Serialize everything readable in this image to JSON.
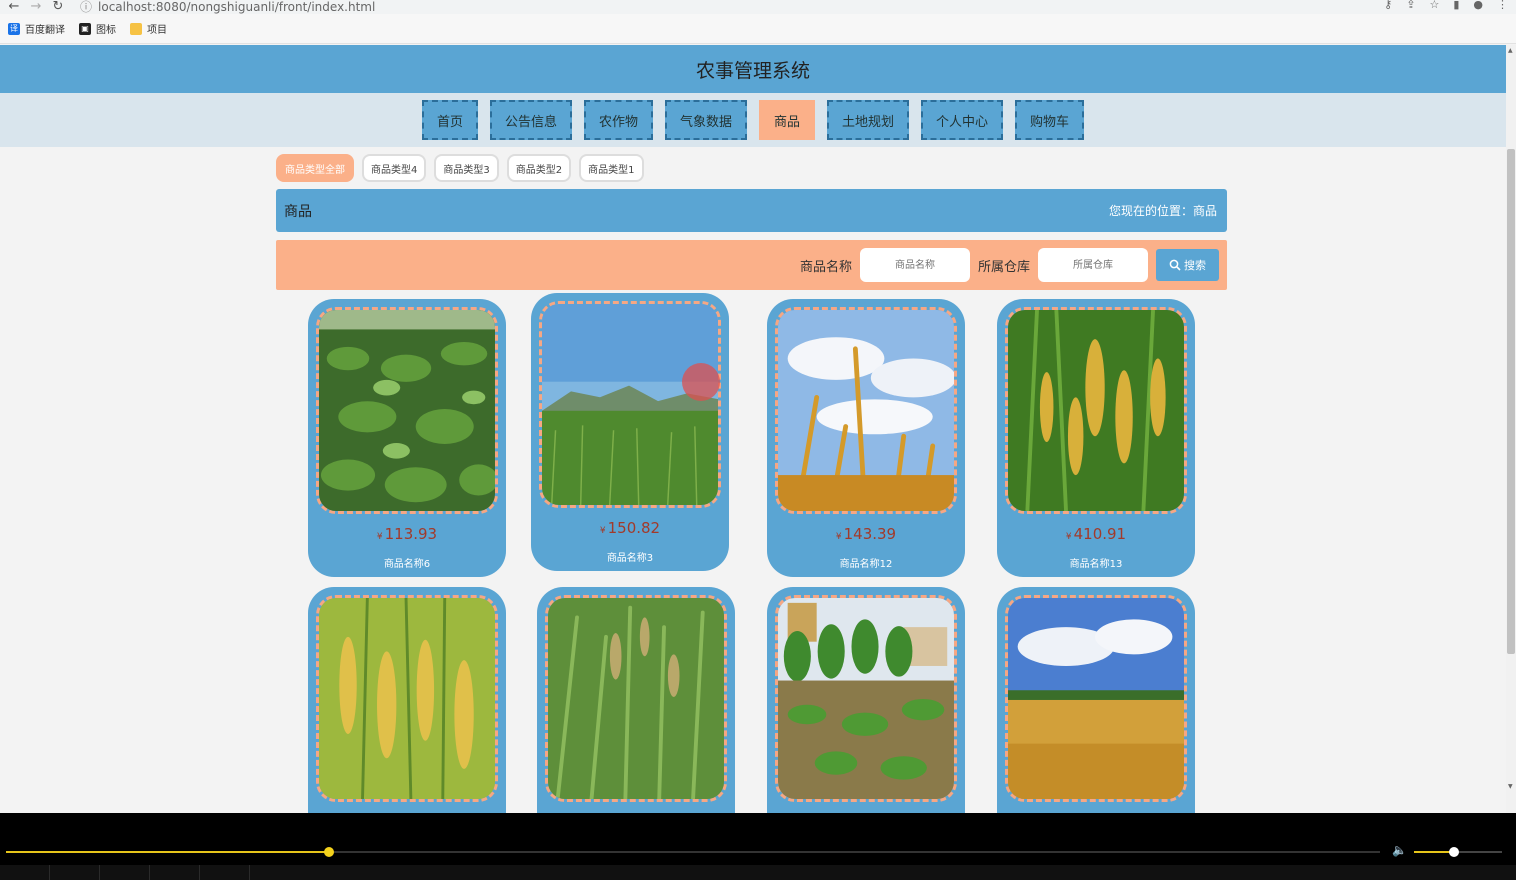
{
  "browser": {
    "url": "localhost:8080/nongshiguanli/front/index.html",
    "bookmarks": [
      {
        "label": "百度翻译",
        "icon": "translate-icon",
        "color": "#1a73e8"
      },
      {
        "label": "图标",
        "icon": "image-icon",
        "color": "#222222"
      },
      {
        "label": "项目",
        "icon": "folder-icon",
        "color": "#f6c244"
      }
    ]
  },
  "header": {
    "title": "农事管理系统"
  },
  "nav": {
    "items": [
      "首页",
      "公告信息",
      "农作物",
      "气象数据",
      "商品",
      "土地规划",
      "个人中心",
      "购物车"
    ],
    "active_index": 4
  },
  "categories": {
    "items": [
      "商品类型全部",
      "商品类型4",
      "商品类型3",
      "商品类型2",
      "商品类型1"
    ],
    "active_index": 0
  },
  "breadcrumb": {
    "title": "商品",
    "location_label": "您现在的位置：",
    "location_value": "商品"
  },
  "search": {
    "name_label": "商品名称",
    "name_placeholder": "商品名称",
    "warehouse_label": "所属仓库",
    "warehouse_placeholder": "所属仓库",
    "button_label": "搜索"
  },
  "products": [
    {
      "currency": "¥",
      "price": "113.93",
      "name": "商品名称6",
      "image": "tea-field"
    },
    {
      "currency": "¥",
      "price": "150.82",
      "name": "商品名称3",
      "image": "green-field-mountains"
    },
    {
      "currency": "¥",
      "price": "143.39",
      "name": "商品名称12",
      "image": "wheat-sky"
    },
    {
      "currency": "¥",
      "price": "410.91",
      "name": "商品名称13",
      "image": "rice-ears"
    },
    {
      "currency": "",
      "price": "",
      "name": "",
      "image": "golden-rice"
    },
    {
      "currency": "",
      "price": "",
      "name": "",
      "image": "green-rice"
    },
    {
      "currency": "",
      "price": "",
      "name": "",
      "image": "farm-trees"
    },
    {
      "currency": "",
      "price": "",
      "name": "",
      "image": "wheat-field-clouds"
    }
  ],
  "colors": {
    "primary": "#5aa5d3",
    "accent": "#fbb089",
    "price": "#a23a2a"
  },
  "player": {
    "progress": 0.235,
    "volume": 0.45
  }
}
